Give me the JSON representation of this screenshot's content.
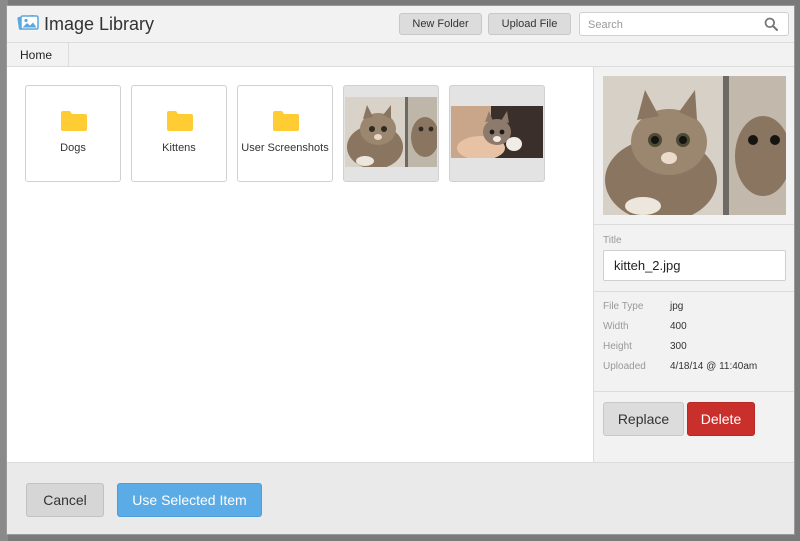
{
  "header": {
    "title": "Image Library",
    "new_folder_label": "New Folder",
    "upload_file_label": "Upload File",
    "search_placeholder": "Search"
  },
  "breadcrumb": {
    "home_label": "Home"
  },
  "grid": {
    "folders": [
      {
        "label": "Dogs",
        "icon": "folder-icon"
      },
      {
        "label": "Kittens",
        "icon": "folder-icon"
      },
      {
        "label": "User Screenshots",
        "icon": "folder-icon"
      }
    ],
    "images": [
      {
        "name": "kitten-mirror-thumbnail"
      },
      {
        "name": "kitten-hand-thumbnail"
      }
    ]
  },
  "details": {
    "title_label": "Title",
    "title_value": "kitteh_2.jpg",
    "meta": [
      {
        "key": "File Type",
        "value": "jpg"
      },
      {
        "key": "Width",
        "value": "400"
      },
      {
        "key": "Height",
        "value": "300"
      },
      {
        "key": "Uploaded",
        "value": "4/18/14 @ 11:40am"
      }
    ],
    "replace_label": "Replace",
    "delete_label": "Delete"
  },
  "footer": {
    "cancel_label": "Cancel",
    "use_label": "Use Selected Item"
  },
  "colors": {
    "primary": "#5aabe6",
    "danger": "#c9302c",
    "folder": "#ffcc33"
  }
}
